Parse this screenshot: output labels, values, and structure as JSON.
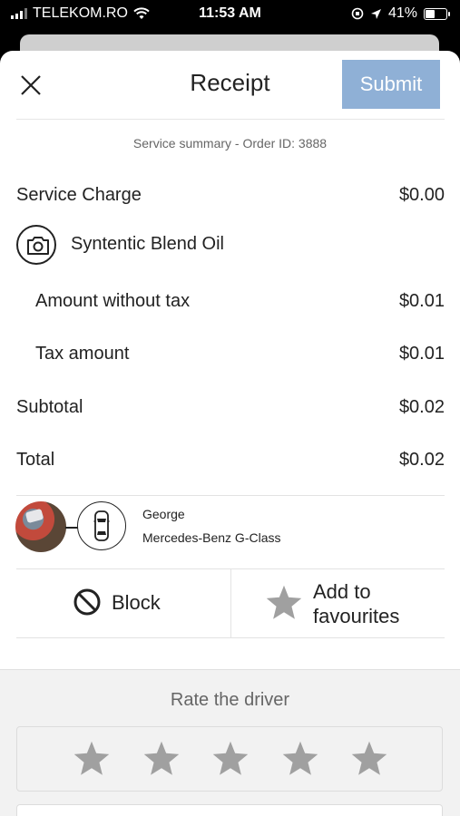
{
  "status_bar": {
    "carrier": "TELEKOM.RO",
    "time": "11:53 AM",
    "battery": "41%",
    "battery_level": 0.41
  },
  "header": {
    "title": "Receipt",
    "submit_label": "Submit"
  },
  "summary": {
    "order_text": "Service summary - Order ID: 3888"
  },
  "lines": {
    "service_charge": {
      "label": "Service Charge",
      "amount": "$0.00"
    },
    "item": {
      "name": "Syntentic Blend Oil"
    },
    "amount_without_tax": {
      "label": "Amount without tax",
      "amount": "$0.01"
    },
    "tax_amount": {
      "label": "Tax amount",
      "amount": "$0.01"
    },
    "subtotal": {
      "label": "Subtotal",
      "amount": "$0.02"
    },
    "total": {
      "label": "Total",
      "amount": "$0.02"
    }
  },
  "driver": {
    "name": "George",
    "car": "Mercedes-Benz G-Class"
  },
  "actions": {
    "block_label": "Block",
    "favourite_label_line1": "Add to",
    "favourite_label_line2": "favourites"
  },
  "rating": {
    "title": "Rate the driver",
    "max_stars": 5,
    "selected": 0
  },
  "colors": {
    "submit_bg": "#8fb0d6",
    "star": "#a0a0a0",
    "rating_bg": "#f2f2f2"
  },
  "icons": [
    "close-icon",
    "camera-icon",
    "car-icon",
    "block-icon",
    "star-icon",
    "wifi-icon",
    "location-arrow-icon",
    "battery-icon"
  ]
}
